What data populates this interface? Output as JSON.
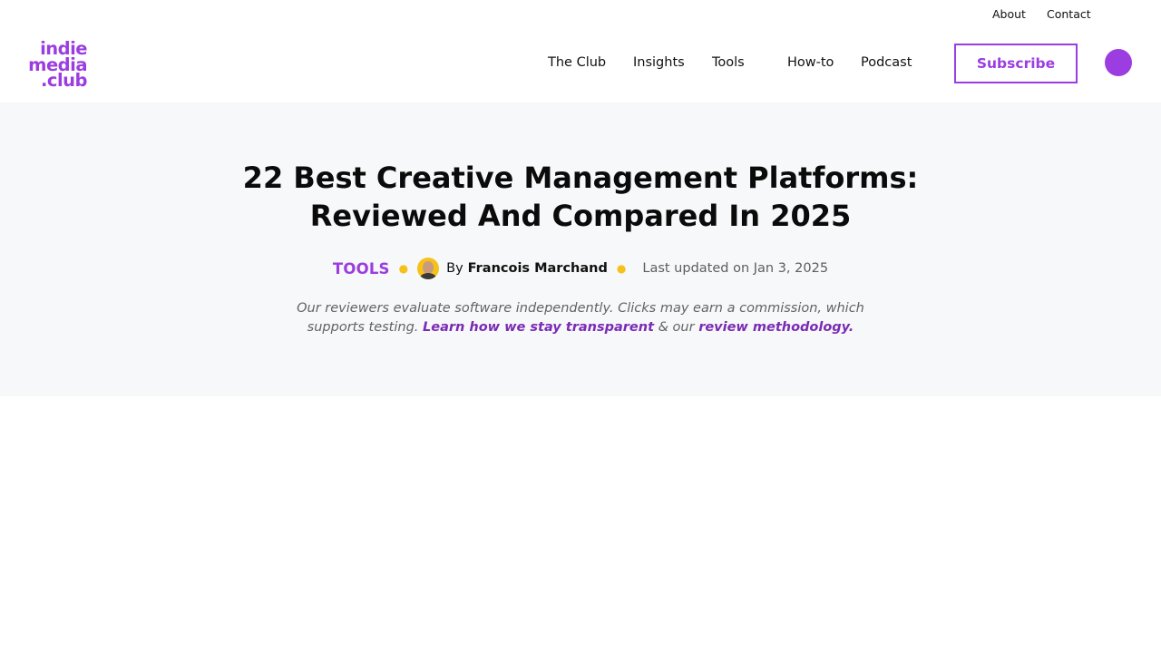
{
  "utility_nav": {
    "about": "About",
    "contact": "Contact"
  },
  "header": {
    "logo_lines": [
      "indie",
      "media",
      ".club"
    ],
    "nav": {
      "club": "The Club",
      "insights": "Insights",
      "tools": "Tools",
      "howto": "How-to",
      "podcast": "Podcast"
    },
    "subscribe_label": "Subscribe"
  },
  "article": {
    "title_line1": "22 Best Creative Management Platforms:",
    "title_line2": "Reviewed And Compared In 2025",
    "category": "TOOLS",
    "by_label": "By",
    "author": "Francois Marchand",
    "updated": "Last updated on Jan 3, 2025",
    "disclaimer_line1": "Our reviewers evaluate software independently. Clicks may earn a commission, which",
    "disclaimer_line2_prefix": "supports testing.",
    "transparent_link": "Learn how we stay transparent",
    "connector": "& our",
    "methodology_link": "review methodology."
  },
  "colors": {
    "brand": "#9b3de0",
    "accent_dot": "#f4c21a",
    "hero_bg": "#f7f8f9"
  }
}
